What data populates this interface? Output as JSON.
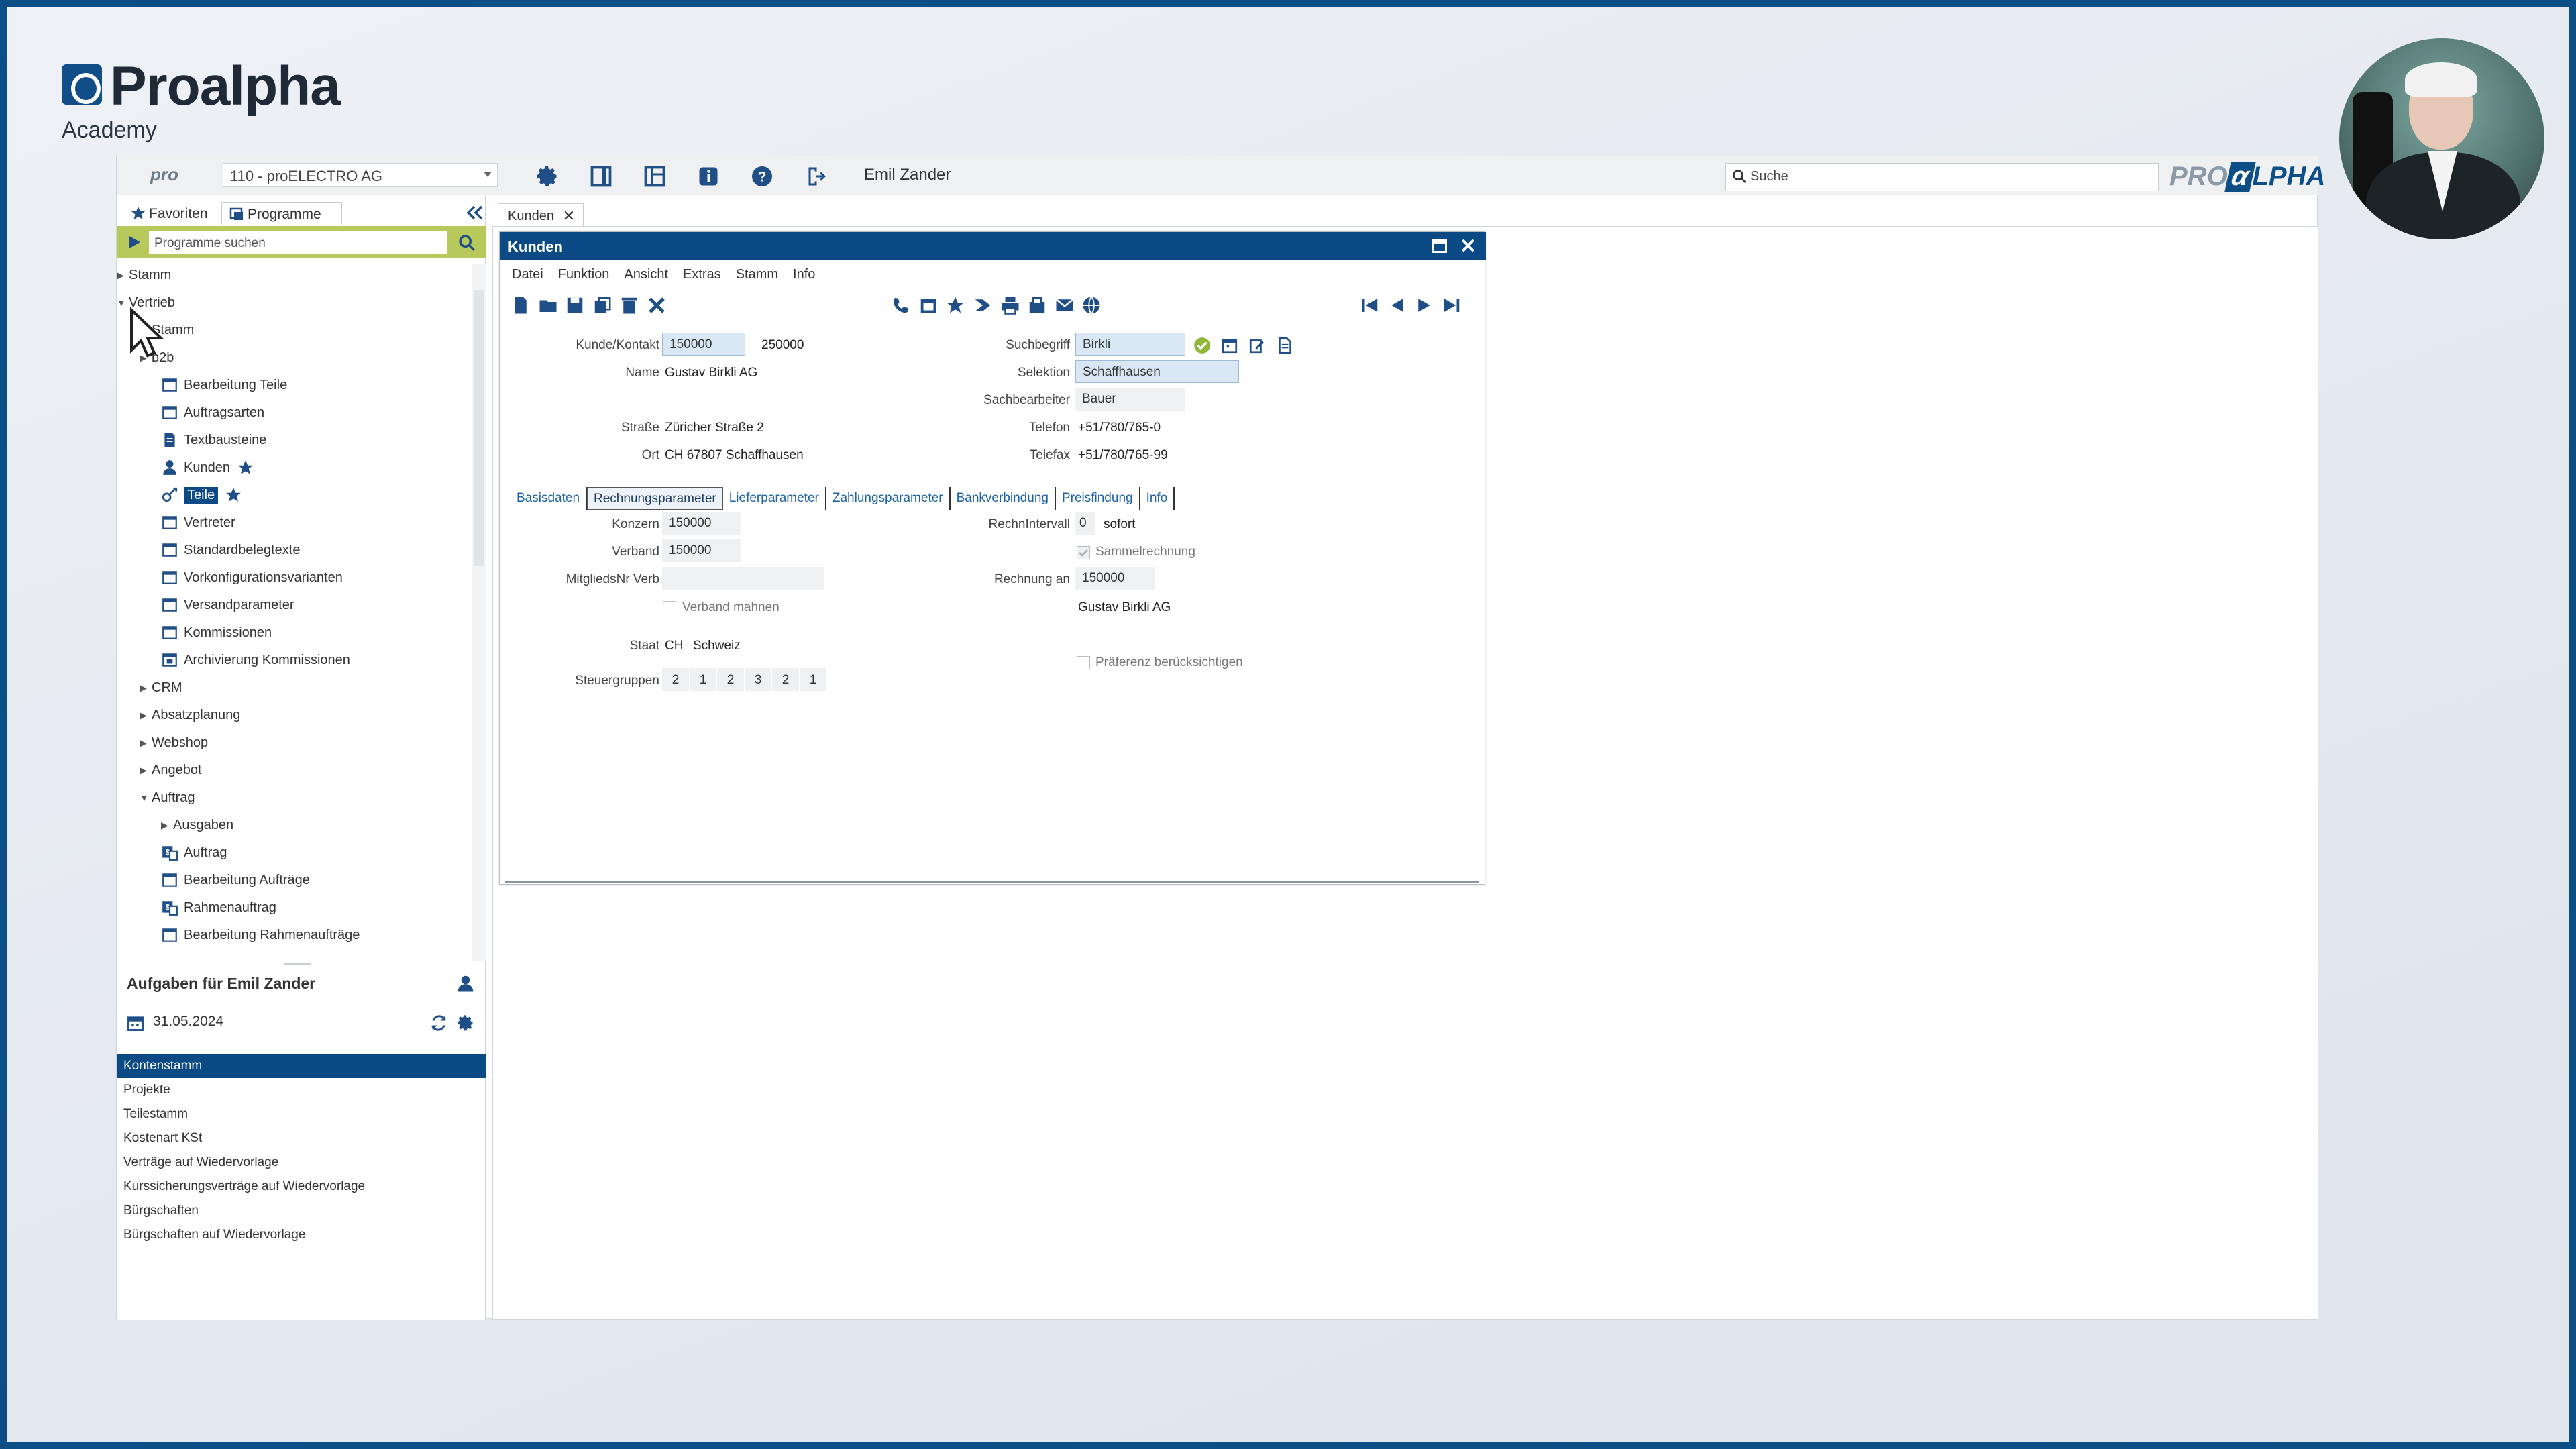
{
  "brand": {
    "name": "Proalpha",
    "subtitle": "Academy"
  },
  "colors": {
    "accent": "#0c4a86",
    "search_bar": "#b7c95a",
    "brand_blue": "#114d87"
  },
  "toolbar": {
    "pro_label": "pro",
    "context": "110 - proELECTRO AG",
    "user": "Emil Zander",
    "search_placeholder": "Suche",
    "logo_text_left": "PRO",
    "logo_text_alpha": "α",
    "logo_text_right": "LPHA"
  },
  "toolbar_icons": [
    "gear-icon",
    "panel-icon",
    "layout-icon",
    "info-icon",
    "help-icon",
    "exit-icon"
  ],
  "left_panel": {
    "tabs": {
      "favorites": "Favoriten",
      "programs": "Programme"
    },
    "search_placeholder": "Programme suchen",
    "tree": [
      {
        "label": "Stamm",
        "level": 0,
        "state": "collapsed"
      },
      {
        "label": "Vertrieb",
        "level": 0,
        "state": "expanded"
      },
      {
        "label": "Stamm",
        "level": 1,
        "state": "leaf"
      },
      {
        "label": "b2b",
        "level": 1,
        "state": "collapsed"
      },
      {
        "label": "Bearbeitung Teile",
        "level": 2,
        "icon": "window-icon"
      },
      {
        "label": "Auftragsarten",
        "level": 2,
        "icon": "window-icon"
      },
      {
        "label": "Textbausteine",
        "level": 2,
        "icon": "document-icon"
      },
      {
        "label": "Kunden",
        "level": 2,
        "icon": "person-icon",
        "favorite": true
      },
      {
        "label": "Teile",
        "level": 2,
        "icon": "parts-icon",
        "favorite": true,
        "selected": true
      },
      {
        "label": "Vertreter",
        "level": 2,
        "icon": "window-icon"
      },
      {
        "label": "Standardbelegtexte",
        "level": 2,
        "icon": "window-icon"
      },
      {
        "label": "Vorkonfigurationsvarianten",
        "level": 2,
        "icon": "window-icon"
      },
      {
        "label": "Versandparameter",
        "level": 2,
        "icon": "window-icon"
      },
      {
        "label": "Kommissionen",
        "level": 2,
        "icon": "window-icon"
      },
      {
        "label": "Archivierung Kommissionen",
        "level": 2,
        "icon": "archive-icon"
      },
      {
        "label": "CRM",
        "level": 1,
        "state": "collapsed"
      },
      {
        "label": "Absatzplanung",
        "level": 1,
        "state": "collapsed"
      },
      {
        "label": "Webshop",
        "level": 1,
        "state": "collapsed"
      },
      {
        "label": "Angebot",
        "level": 1,
        "state": "collapsed"
      },
      {
        "label": "Auftrag",
        "level": 1,
        "state": "expanded"
      },
      {
        "label": "Ausgaben",
        "level": 2,
        "state": "collapsed"
      },
      {
        "label": "Auftrag",
        "level": 2,
        "icon": "order-icon"
      },
      {
        "label": "Bearbeitung Aufträge",
        "level": 2,
        "icon": "window-icon"
      },
      {
        "label": "Rahmenauftrag",
        "level": 2,
        "icon": "order-icon"
      },
      {
        "label": "Bearbeitung Rahmenaufträge",
        "level": 2,
        "icon": "window-icon"
      }
    ],
    "tasks": {
      "title": "Aufgaben für Emil Zander",
      "date": "31.05.2024",
      "items": [
        "Kontenstamm",
        "Projekte",
        "Teilestamm",
        "Kostenart KSt",
        "Verträge auf Wiedervorlage",
        "Kurssicherungsverträge auf Wiedervorlage",
        "Bürgschaften",
        "Bürgschaften auf Wiedervorlage"
      ],
      "selected_index": 0
    }
  },
  "doc_tab": "Kunden",
  "dialog": {
    "title": "Kunden",
    "menu": [
      "Datei",
      "Funktion",
      "Ansicht",
      "Extras",
      "Stamm",
      "Info"
    ],
    "fields": {
      "kunde_label": "Kunde/Kontakt",
      "kunde_value": "150000",
      "kontakt_value": "250000",
      "name_label": "Name",
      "name_value": "Gustav Birkli AG",
      "strasse_label": "Straße",
      "strasse_value": "Züricher Straße 2",
      "ort_label": "Ort",
      "ort_value": "CH 67807 Schaffhausen",
      "suchbegriff_label": "Suchbegriff",
      "suchbegriff_value": "Birkli",
      "selektion_label": "Selektion",
      "selektion_value": "Schaffhausen",
      "sachbearbeiter_label": "Sachbearbeiter",
      "sachbearbeiter_value": "Bauer",
      "telefon_label": "Telefon",
      "telefon_value": "+51/780/765-0",
      "telefax_label": "Telefax",
      "telefax_value": "+51/780/765-99"
    },
    "tabs": [
      "Basisdaten",
      "Rechnungsparameter",
      "Lieferparameter",
      "Zahlungsparameter",
      "Bankverbindung",
      "Preisfindung",
      "Info"
    ],
    "active_tab": "Rechnungsparameter",
    "rechnung": {
      "konzern_label": "Konzern",
      "konzern_value": "150000",
      "verband_label": "Verband",
      "verband_value": "150000",
      "mitglied_label": "MitgliedsNr Verb",
      "mitglied_value": "",
      "verband_mahnen": "Verband mahnen",
      "staat_label": "Staat",
      "staat_code": "CH",
      "staat_name": "Schweiz",
      "steuer_label": "Steuergruppen",
      "steuer_values": [
        "2",
        "1",
        "2",
        "3",
        "2",
        "1"
      ],
      "intervall_label": "RechnIntervall",
      "intervall_value": "0",
      "intervall_text": "sofort",
      "sammel_label": "Sammelrechnung",
      "rechnung_an_label": "Rechnung an",
      "rechnung_an_value": "150000",
      "rechnung_an_name": "Gustav Birkli AG",
      "praeferenz_label": "Präferenz berücksichtigen"
    }
  }
}
